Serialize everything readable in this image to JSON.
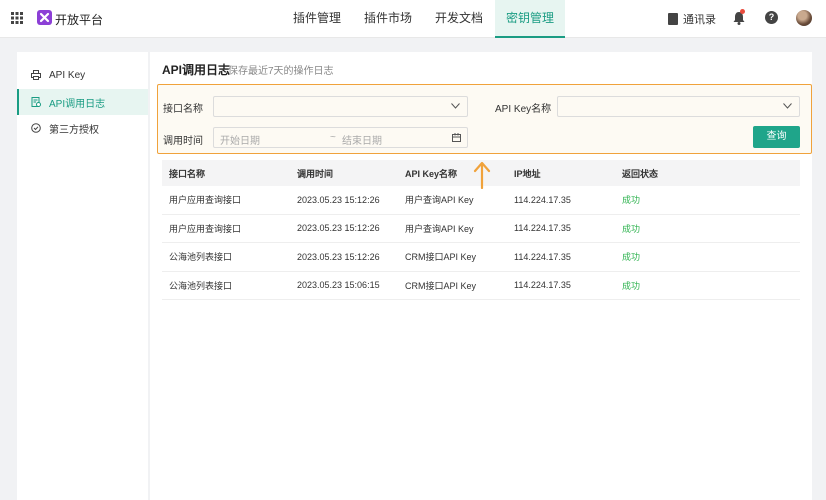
{
  "header": {
    "app_title": "开放平台",
    "nav": [
      "插件管理",
      "插件市场",
      "开发文档",
      "密钥管理"
    ],
    "active_nav": "密钥管理",
    "contacts_label": "通讯录",
    "help_glyph": "?",
    "accent_color": "#1a9c83"
  },
  "sidebar": {
    "items": [
      {
        "label": "API Key",
        "icon": "printer-icon"
      },
      {
        "label": "API调用日志",
        "icon": "log-document-icon"
      },
      {
        "label": "第三方授权",
        "icon": "check-circle-icon"
      }
    ],
    "active_item": "API调用日志"
  },
  "main": {
    "title": "API调用日志",
    "subtitle": "保存最近7天的操作日志"
  },
  "filters": {
    "interface_label": "接口名称",
    "interface_value": "",
    "apikey_label": "API Key名称",
    "apikey_value": "",
    "time_label": "调用时间",
    "start_placeholder": "开始日期",
    "separator": "~",
    "end_placeholder": "结束日期",
    "query_button": "查询",
    "highlight_color": "#f0a23b"
  },
  "table": {
    "columns": [
      "接口名称",
      "调用时间",
      "API Key名称",
      "IP地址",
      "返回状态"
    ],
    "rows": [
      [
        "用户应用查询接口",
        "2023.05.23 15:12:26",
        "用户查询API Key",
        "114.224.17.35",
        "成功"
      ],
      [
        "用户应用查询接口",
        "2023.05.23 15:12:26",
        "用户查询API Key",
        "114.224.17.35",
        "成功"
      ],
      [
        "公海池列表接口",
        "2023.05.23 15:12:26",
        "CRM接口API Key",
        "114.224.17.35",
        "成功"
      ],
      [
        "公海池列表接口",
        "2023.05.23 15:06:15",
        "CRM接口API Key",
        "114.224.17.35",
        "成功"
      ]
    ],
    "success_color": "#2eb34f"
  }
}
